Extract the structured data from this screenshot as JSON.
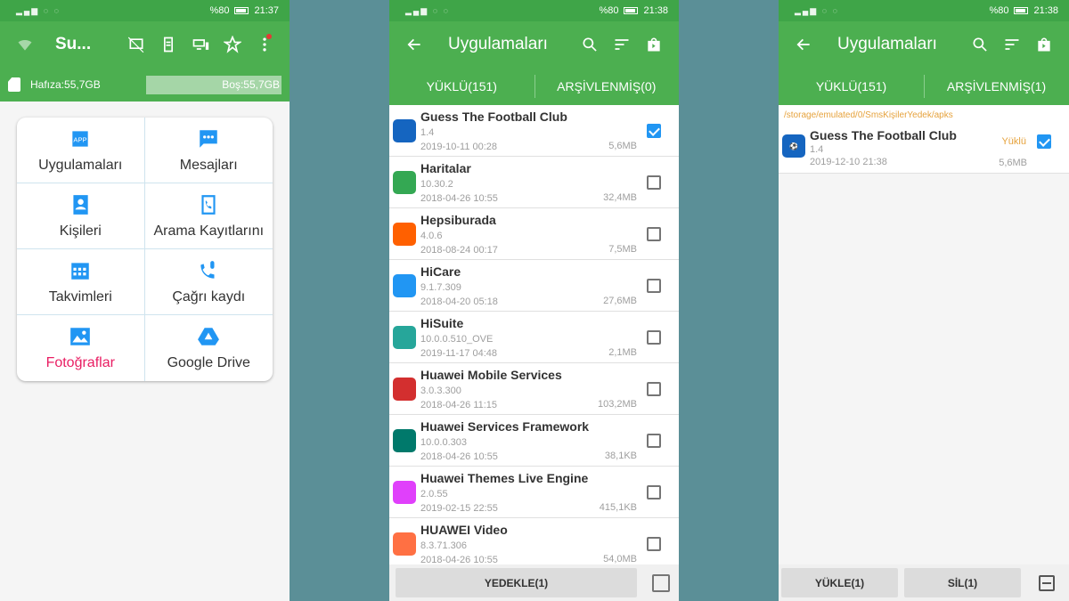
{
  "status": {
    "left": "▂▄▆ ◌ ◌",
    "battery_pct": "%80",
    "time_p1": "21:37",
    "time_p2": "21:38",
    "time_p3": "21:38"
  },
  "p1": {
    "title": "Su...",
    "storage": {
      "used": "Hafıza:55,7GB",
      "free": "Boş:55,7GB"
    },
    "grid": [
      {
        "label": "Uygulamaları",
        "icon": "app-icon"
      },
      {
        "label": "Mesajları",
        "icon": "message-icon"
      },
      {
        "label": "Kişileri",
        "icon": "contacts-icon"
      },
      {
        "label": "Arama Kayıtlarını",
        "icon": "call-log-icon"
      },
      {
        "label": "Takvimleri",
        "icon": "calendar-icon"
      },
      {
        "label": "Çağrı kaydı",
        "icon": "call-record-icon"
      },
      {
        "label": "Fotoğraflar",
        "icon": "photo-icon"
      },
      {
        "label": "Google Drive",
        "icon": "drive-icon"
      }
    ]
  },
  "p2": {
    "title": "Uygulamaları",
    "tabs": [
      "YÜKLÜ(151)",
      "ARŞİVLENMİŞ(0)"
    ],
    "apps": [
      {
        "name": "Guess The Football Club",
        "version": "1.4",
        "date": "2019-10-11 00:28",
        "size": "5,6MB",
        "color": "#1565c0",
        "checked": true
      },
      {
        "name": "Haritalar",
        "version": "10.30.2",
        "date": "2018-04-26 10:55",
        "size": "32,4MB",
        "color": "#34a853",
        "checked": false
      },
      {
        "name": "Hepsiburada",
        "version": "4.0.6",
        "date": "2018-08-24 00:17",
        "size": "7,5MB",
        "color": "#ff6000",
        "checked": false
      },
      {
        "name": "HiCare",
        "version": "9.1.7.309",
        "date": "2018-04-20 05:18",
        "size": "27,6MB",
        "color": "#2196f3",
        "checked": false
      },
      {
        "name": "HiSuite",
        "version": "10.0.0.510_OVE",
        "date": "2019-11-17 04:48",
        "size": "2,1MB",
        "color": "#26a69a",
        "checked": false
      },
      {
        "name": "Huawei Mobile Services",
        "version": "3.0.3.300",
        "date": "2018-04-26 11:15",
        "size": "103,2MB",
        "color": "#d32f2f",
        "checked": false
      },
      {
        "name": "Huawei Services Framework",
        "version": "10.0.0.303",
        "date": "2018-04-26 10:55",
        "size": "38,1KB",
        "color": "#00796b",
        "checked": false
      },
      {
        "name": "Huawei Themes Live Engine",
        "version": "2.0.55",
        "date": "2019-02-15 22:55",
        "size": "415,1KB",
        "color": "#e040fb",
        "checked": false
      },
      {
        "name": "HUAWEI Video",
        "version": "8.3.71.306",
        "date": "2018-04-26 10:55",
        "size": "54,0MB",
        "color": "#ff7043",
        "checked": false
      }
    ],
    "backup_button": "YEDEKLE(1)"
  },
  "p3": {
    "title": "Uygulamaları",
    "tabs": [
      "YÜKLÜ(151)",
      "ARŞİVLENMİŞ(1)"
    ],
    "path": "/storage/emulated/0/SmsKişilerYedek/apks",
    "app": {
      "name": "Guess The Football Club",
      "version": "1.4",
      "date": "2019-12-10 21:38",
      "size": "5,6MB",
      "status": "Yüklü",
      "color": "#1565c0"
    },
    "install_button": "YÜKLE(1)",
    "delete_button": "SİL(1)"
  },
  "colors": {
    "header": "#4caf50",
    "accent": "#2196f3",
    "orange": "#e6a23c"
  }
}
